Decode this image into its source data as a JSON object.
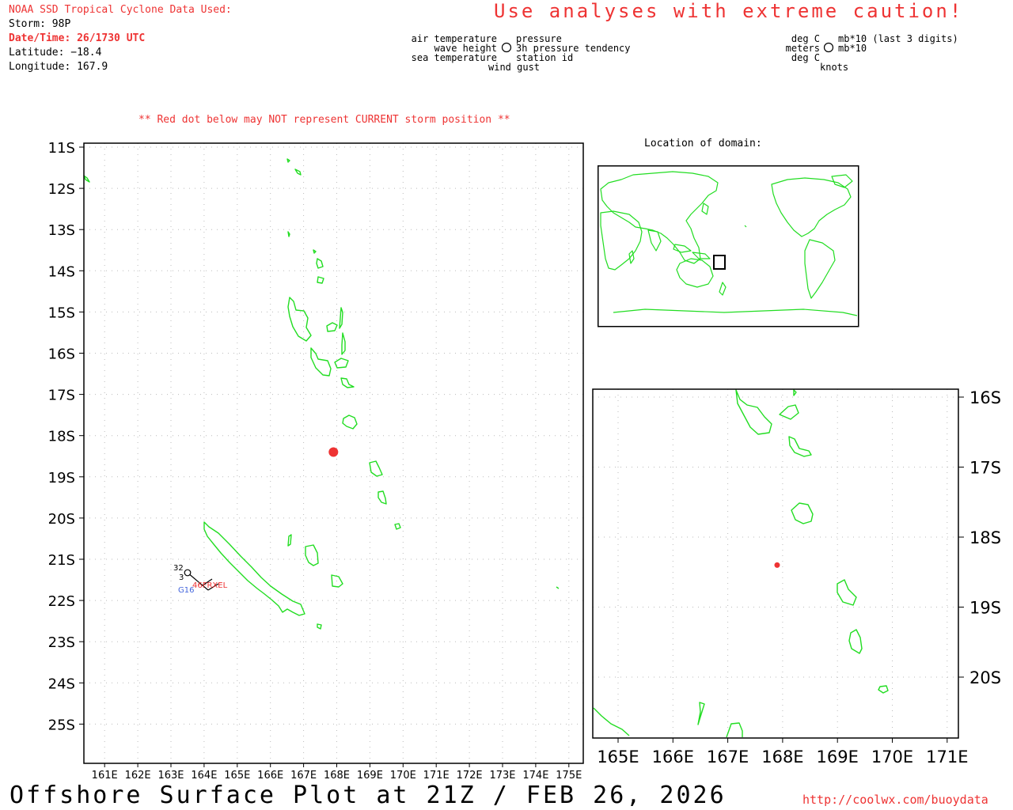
{
  "header": {
    "source_line": "NOAA SSD Tropical Cyclone Data Used:",
    "storm": "Storm: 98P",
    "datetime": "Date/Time: 26/1730 UTC",
    "latitude": "Latitude: −18.4",
    "longitude": "Longitude: 167.9",
    "caution": "Use analyses with extreme caution!"
  },
  "legend_left": {
    "air_temperature": "air temperature",
    "wave_height": "wave height",
    "sea_temperature": "sea temperature",
    "wind_gust": "wind gust",
    "pressure": "pressure",
    "pressure_tendency": "3h pressure tendency",
    "station_id": "station id"
  },
  "legend_right": {
    "deg_c_1": "deg C",
    "meters": "meters",
    "deg_c_2": "deg C",
    "knots": "knots",
    "mb_last3": "mb*10 (last 3 digits)",
    "mb": "mb*10"
  },
  "notice": "** Red dot below may NOT represent CURRENT storm position **",
  "location_label": "Location of domain:",
  "main_map": {
    "lat_labels": [
      "11S",
      "12S",
      "13S",
      "14S",
      "15S",
      "16S",
      "17S",
      "18S",
      "19S",
      "20S",
      "21S",
      "22S",
      "23S",
      "24S",
      "25S"
    ],
    "lon_labels": [
      "161E",
      "162E",
      "163E",
      "164E",
      "165E",
      "166E",
      "167E",
      "168E",
      "169E",
      "170E",
      "171E",
      "172E",
      "173E",
      "174E",
      "175E"
    ],
    "storm_position": {
      "lat": -18.4,
      "lon": 167.9,
      "color": "#ee3333"
    },
    "station": {
      "id": "46FRXEL",
      "air_temperature": "32",
      "sea_temperature": "3",
      "wind_gust": "G16"
    }
  },
  "zoom_map": {
    "lat_labels": [
      "16S",
      "17S",
      "18S",
      "19S",
      "20S"
    ],
    "lon_labels": [
      "165E",
      "166E",
      "167E",
      "168E",
      "169E",
      "170E",
      "171E"
    ]
  },
  "footer": {
    "title": "Offshore Surface Plot at 21Z / FEB 26, 2026",
    "url": "http://coolwx.com/buoydata"
  },
  "colors": {
    "coastline": "#22dd22",
    "accent_red": "#ee3333",
    "station_blue": "#4466dd",
    "grid": "#bbbbbb"
  }
}
